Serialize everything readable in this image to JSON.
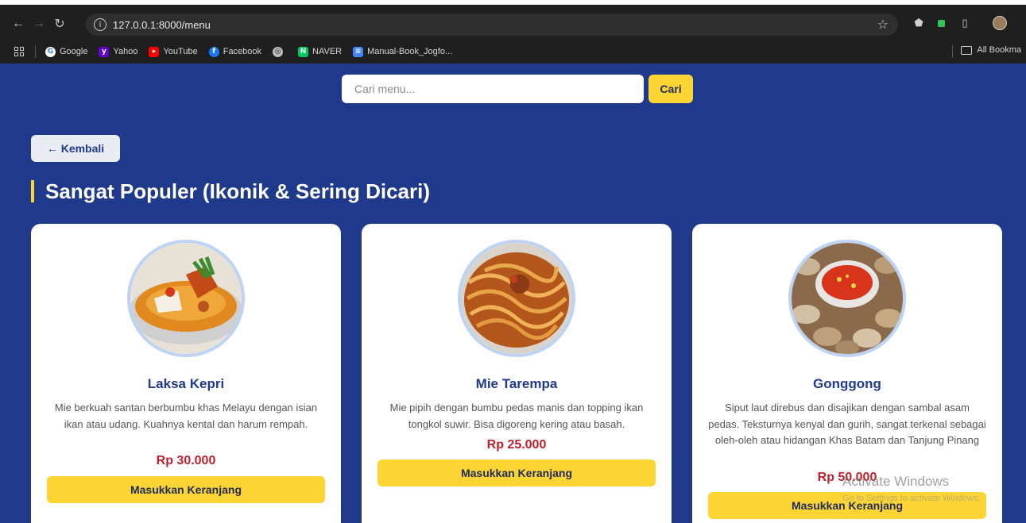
{
  "browser": {
    "url": "127.0.0.1:8000/menu",
    "bookmarks": [
      {
        "label": "Google",
        "icon": "google-icon",
        "color": "#ffffff"
      },
      {
        "label": "Yahoo",
        "icon": "yahoo-icon",
        "color": "#6001d2"
      },
      {
        "label": "YouTube",
        "icon": "youtube-icon",
        "color": "#ff0000"
      },
      {
        "label": "Facebook",
        "icon": "facebook-icon",
        "color": "#1877f2"
      },
      {
        "label": "",
        "icon": "globe-icon",
        "color": "#bdbdbd"
      },
      {
        "label": "NAVER",
        "icon": "naver-icon",
        "color": "#03c75a"
      },
      {
        "label": "Manual-Book_Jogfo...",
        "icon": "docs-icon",
        "color": "#4285f4"
      }
    ],
    "all_bookmarks": "All Bookma"
  },
  "search": {
    "placeholder": "Cari menu...",
    "button": "Cari"
  },
  "back_label": "← Kembali",
  "section_title": "Sangat Populer (Ikonik & Sering Dicari)",
  "cart_label": "Masukkan Keranjang",
  "menu": [
    {
      "name": "Laksa Kepri",
      "description": "Mie berkuah santan berbumbu khas Melayu dengan isian ikan atau udang. Kuahnya kental dan harum rempah.",
      "price": "Rp 30.000",
      "image": "laksa-photo"
    },
    {
      "name": "Mie Tarempa",
      "description": "Mie pipih dengan bumbu pedas manis dan topping ikan tongkol suwir. Bisa digoreng kering atau basah.",
      "price": "Rp 25.000",
      "image": "mie-tarempa-photo"
    },
    {
      "name": "Gonggong",
      "description": "Siput laut direbus dan disajikan dengan sambal asam pedas. Teksturnya kenyal dan gurih, sangat terkenal sebagai oleh-oleh atau hidangan Khas Batam dan Tanjung Pinang",
      "price": "Rp 50.000",
      "image": "gonggong-photo"
    }
  ],
  "watermark": {
    "title": "Activate Windows",
    "subtitle": "Go to Settings to activate Windows."
  },
  "colors": {
    "page_bg": "#1f3a8a",
    "accent": "#fcd535",
    "price": "#c0202a",
    "title": "#1f3a8a"
  }
}
